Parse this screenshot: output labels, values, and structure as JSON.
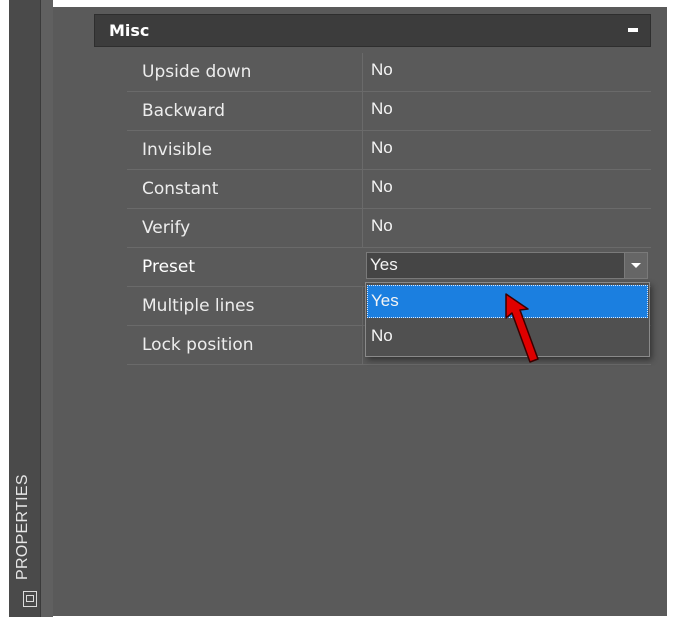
{
  "panel": {
    "side_tab_label": "PROPERTIES",
    "side_tab_icon": "properties-palette-icon"
  },
  "section": {
    "title": "Misc",
    "collapse_icon": "collapse-minus-icon"
  },
  "properties": [
    {
      "name": "Upside down",
      "value": "No"
    },
    {
      "name": "Backward",
      "value": "No"
    },
    {
      "name": "Invisible",
      "value": "No"
    },
    {
      "name": "Constant",
      "value": "No"
    },
    {
      "name": "Verify",
      "value": "No"
    },
    {
      "name": "Preset",
      "value": "Yes"
    },
    {
      "name": "Multiple lines",
      "value": ""
    },
    {
      "name": "Lock position",
      "value": ""
    }
  ],
  "dropdown": {
    "options": [
      "Yes",
      "No"
    ],
    "highlighted": "Yes",
    "button_icon": "chevron-down-icon"
  },
  "colors": {
    "highlight": "#1b7fe0",
    "cursor": "#e00000"
  }
}
